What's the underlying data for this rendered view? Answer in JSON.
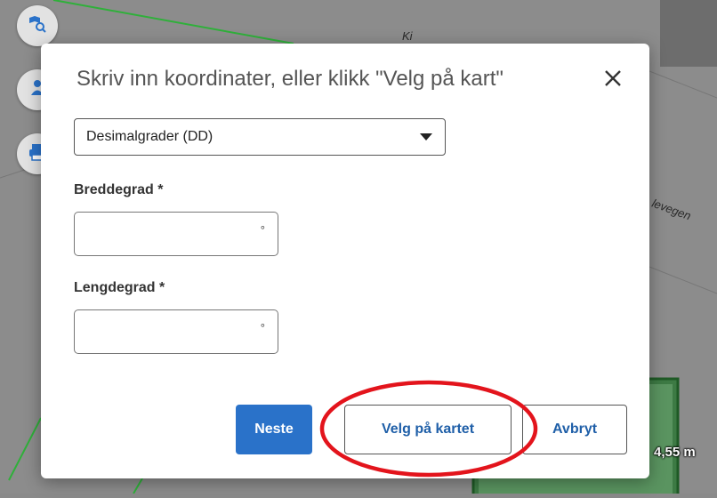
{
  "map": {
    "labels": {
      "road_fragment": "Ki",
      "road_name": "levegen"
    },
    "measurement": "4,55 m",
    "buttons": [
      {
        "name": "search-map-icon"
      },
      {
        "name": "person-location-icon"
      },
      {
        "name": "print-icon"
      }
    ]
  },
  "dialog": {
    "title": "Skriv inn koordinater, eller klikk \"Velg på kart\"",
    "close_icon": "close-icon",
    "format_select": {
      "value": "Desimalgrader (DD)"
    },
    "latitude": {
      "label": "Breddegrad *",
      "value": "",
      "unit": "°"
    },
    "longitude": {
      "label": "Lengdegrad *",
      "value": "",
      "unit": "°"
    },
    "buttons": {
      "next": "Neste",
      "choose_on_map": "Velg på kartet",
      "cancel": "Avbryt"
    }
  },
  "colors": {
    "primary": "#2a72c9",
    "link_text": "#1f5fa8",
    "highlight": "#e3141c",
    "map_green": "#2fb03a"
  }
}
